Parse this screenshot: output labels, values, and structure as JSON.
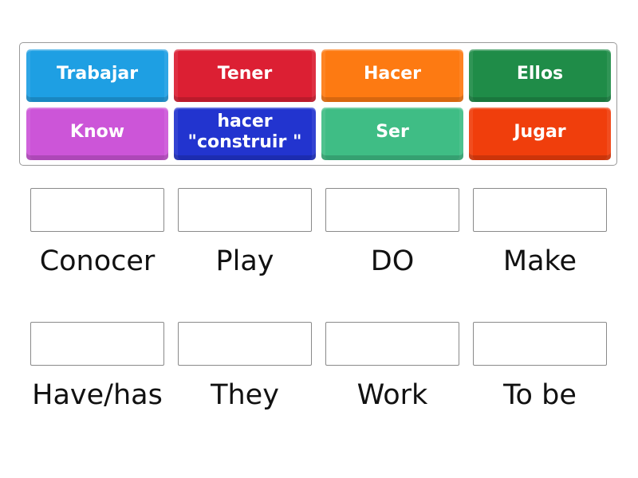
{
  "tiles": [
    {
      "label": "Trabajar",
      "color": "#1e9fe3"
    },
    {
      "label": "Tener",
      "color": "#dc1f33"
    },
    {
      "label": "Hacer",
      "color": "#fd7a12"
    },
    {
      "label": "Ellos",
      "color": "#1f8c48"
    },
    {
      "label": "Know",
      "color": "#cc55d8"
    },
    {
      "label": "hacer \"construir \"",
      "color": "#2234cf"
    },
    {
      "label": "Ser",
      "color": "#3fbd85"
    },
    {
      "label": "Jugar",
      "color": "#f03e0c"
    }
  ],
  "targets": [
    {
      "label": "Conocer",
      "answer": ""
    },
    {
      "label": "Play",
      "answer": ""
    },
    {
      "label": "DO",
      "answer": ""
    },
    {
      "label": "Make",
      "answer": ""
    },
    {
      "label": "Have/has",
      "answer": ""
    },
    {
      "label": "They",
      "answer": ""
    },
    {
      "label": "Work",
      "answer": ""
    },
    {
      "label": "To be",
      "answer": ""
    }
  ]
}
